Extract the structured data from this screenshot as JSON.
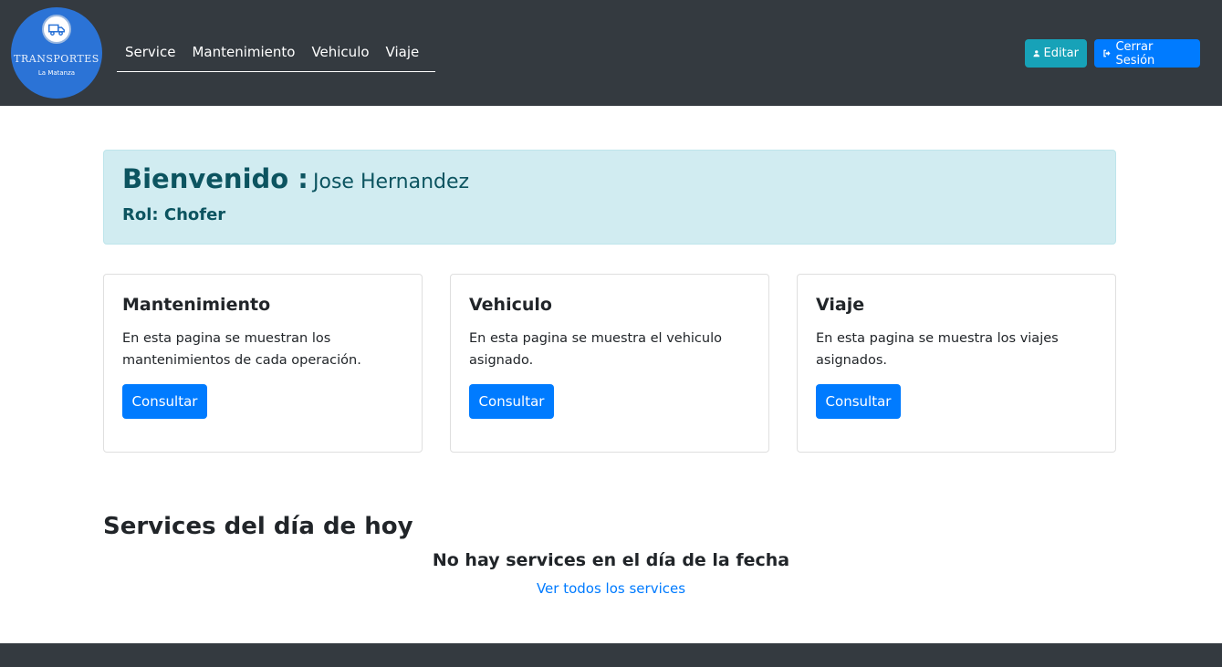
{
  "brand": {
    "title": "TRANSPORTES",
    "subtitle": "La Matanza",
    "icon": "truck-icon"
  },
  "nav": {
    "links": [
      {
        "label": "Service"
      },
      {
        "label": "Mantenimiento"
      },
      {
        "label": "Vehiculo"
      },
      {
        "label": "Viaje"
      }
    ],
    "edit_label": "Editar",
    "logout_label": "Cerrar Sesión"
  },
  "welcome": {
    "label": "Bienvenido :",
    "name": "Jose Hernandez",
    "role": "Rol: Chofer"
  },
  "cards": [
    {
      "title": "Mantenimiento",
      "text": "En esta pagina se muestran los mantenimientos de cada operación.",
      "button": "Consultar"
    },
    {
      "title": "Vehiculo",
      "text": "En esta pagina se muestra el vehiculo asignado.",
      "button": "Consultar"
    },
    {
      "title": "Viaje",
      "text": "En esta pagina se muestra los viajes asignados.",
      "button": "Consultar"
    }
  ],
  "services": {
    "title": "Services del día de hoy",
    "empty_message": "No hay services en el día de la fecha",
    "link_label": "Ver todos los services"
  },
  "colors": {
    "navbar": "#343a40",
    "primary": "#007bff",
    "info": "#17a2b8",
    "alert_bg": "#d1ecf1",
    "alert_text": "#0c5460"
  }
}
